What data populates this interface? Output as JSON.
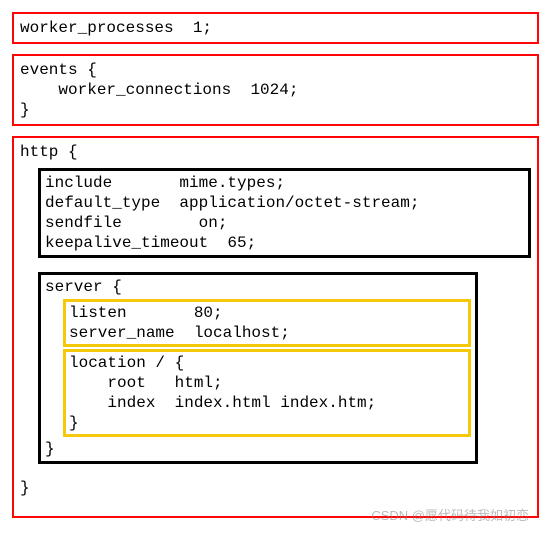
{
  "block_worker": "worker_processes  1;",
  "block_events_open": "events {",
  "block_events_body": "    worker_connections  1024;",
  "block_events_close": "}",
  "http_open": "http {",
  "http_core": "include       mime.types;\ndefault_type  application/octet-stream;\nsendfile        on;\nkeepalive_timeout  65;",
  "server_open": "server {",
  "server_listen": "listen       80;\nserver_name  localhost;",
  "server_location": "location / {\n    root   html;\n    index  index.html index.htm;\n}",
  "server_close": "}",
  "http_close": "}",
  "watermark": "CSDN @愿代码待我如初恋"
}
